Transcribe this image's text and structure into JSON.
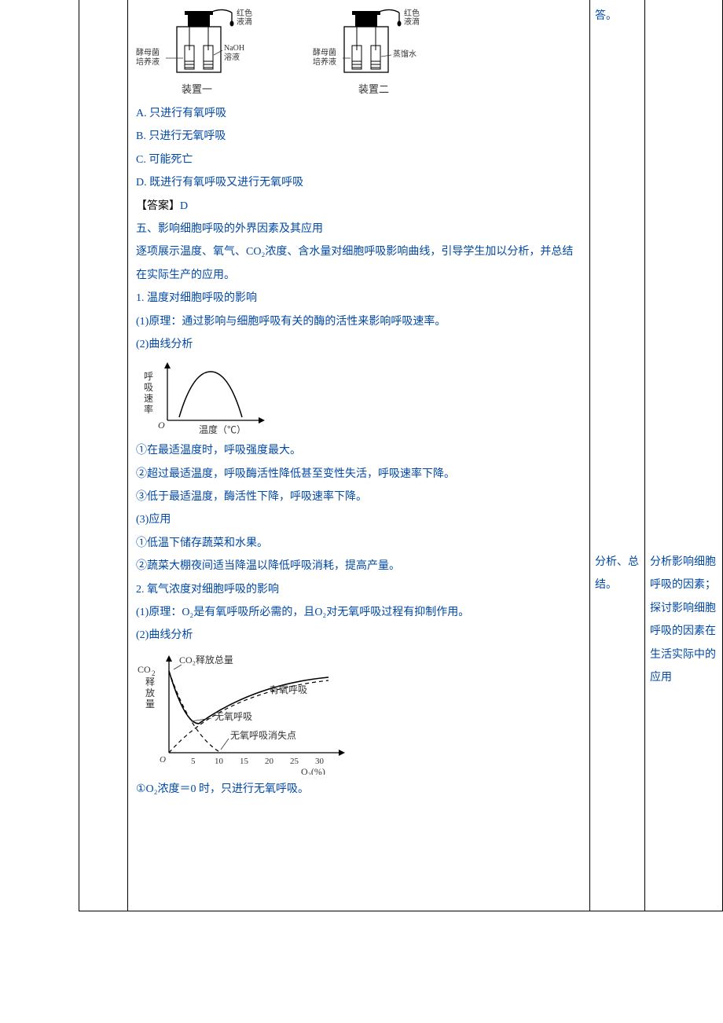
{
  "apparatus": {
    "drop_label": "红色\n液滴",
    "yeast_label": "酵母菌\n培养液",
    "naoh_label": "NaOH\n溶液",
    "water_label": "蒸馏水",
    "device1": "装置一",
    "device2": "装置二"
  },
  "options": {
    "A": "A. 只进行有氧呼吸",
    "B": "B. 只进行无氧呼吸",
    "C": "C. 可能死亡",
    "D": "D. 既进行有氧呼吸又进行无氧呼吸"
  },
  "answer_label": "【答案】",
  "answer_value": "D",
  "section5_title": "五、影响细胞呼吸的外界因素及其应用",
  "section5_intro": "逐项展示温度、氧气、CO₂浓度、含水量对细胞呼吸影响曲线，引导学生加以分析，并总结在实际生产的应用。",
  "temp": {
    "heading": "1. 温度对细胞呼吸的影响",
    "principle": "(1)原理：通过影响与细胞呼吸有关的酶的活性来影响呼吸速率。",
    "curve_title": "(2)曲线分析",
    "ylabel": "呼吸速率",
    "xlabel": "温度（℃）",
    "origin": "O",
    "b1": "①在最适温度时，呼吸强度最大。",
    "b2": "②超过最适温度，呼吸酶活性降低甚至变性失活，呼吸速率下降。",
    "b3": "③低于最适温度，酶活性下降，呼吸速率下降。",
    "app_title": "(3)应用",
    "a1": "①低温下储存蔬菜和水果。",
    "a2": "②蔬菜大棚夜间适当降温以降低呼吸消耗，提高产量。"
  },
  "o2": {
    "heading": "2. 氧气浓度对细胞呼吸的影响",
    "principle": "(1)原理：O₂是有氧呼吸所必需的，且O₂对无氧呼吸过程有抑制作用。",
    "curve_title": "(2)曲线分析",
    "ylabel": "CO₂释放量",
    "top_label": "CO₂释放总量",
    "aerobic": "有氧呼吸",
    "anaerobic": "无氧呼吸",
    "vanish": "无氧呼吸消失点",
    "origin": "O",
    "xlabel": "O₂(%)",
    "ticks": [
      "5",
      "10",
      "15",
      "20",
      "25",
      "30"
    ],
    "b1": "①O₂浓度＝0 时，只进行无氧呼吸。"
  },
  "col3": {
    "top": "答。",
    "bottom": "分析、总结。"
  },
  "col4": {
    "text": "分析影响细胞呼吸的因素；探讨影响细胞呼吸的因素在生活实际中的应用"
  }
}
